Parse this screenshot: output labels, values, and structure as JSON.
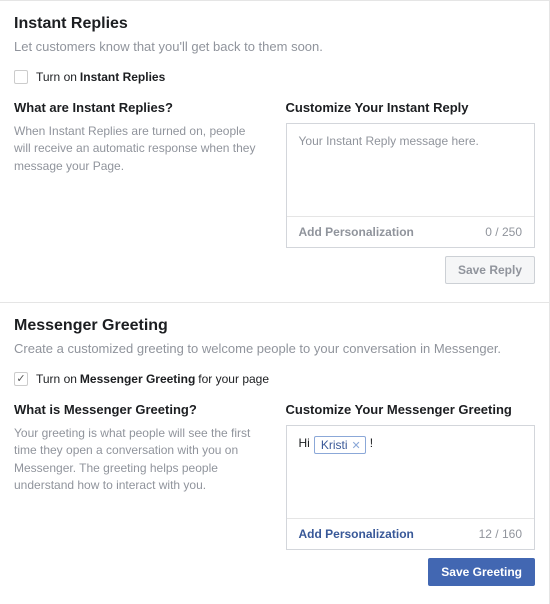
{
  "instant": {
    "title": "Instant Replies",
    "desc": "Let customers know that you'll get back to them soon.",
    "checkbox": {
      "checked": false,
      "prefix": "Turn on ",
      "bold": "Instant Replies"
    },
    "left": {
      "heading": "What are Instant Replies?",
      "help": "When Instant Replies are turned on, people will receive an automatic response when they message your Page."
    },
    "right": {
      "heading": "Customize Your Instant Reply",
      "placeholder": "Your Instant Reply message here.",
      "addPersonalization": "Add Personalization",
      "count": "0 / 250",
      "saveLabel": "Save Reply"
    }
  },
  "greeting": {
    "title": "Messenger Greeting",
    "desc": "Create a customized greeting to welcome people to your conversation in Messenger.",
    "checkbox": {
      "checked": true,
      "prefix": "Turn on ",
      "bold": "Messenger Greeting",
      "suffix": " for your page"
    },
    "left": {
      "heading": "What is Messenger Greeting?",
      "help": "Your greeting is what people will see the first time they open a conversation with you on Messenger. The greeting helps people understand how to interact with you."
    },
    "right": {
      "heading": "Customize Your Messenger Greeting",
      "pre": "Hi ",
      "tag": "Kristi",
      "post": " !",
      "addPersonalization": "Add Personalization",
      "count": "12 / 160",
      "saveLabel": "Save Greeting"
    }
  }
}
